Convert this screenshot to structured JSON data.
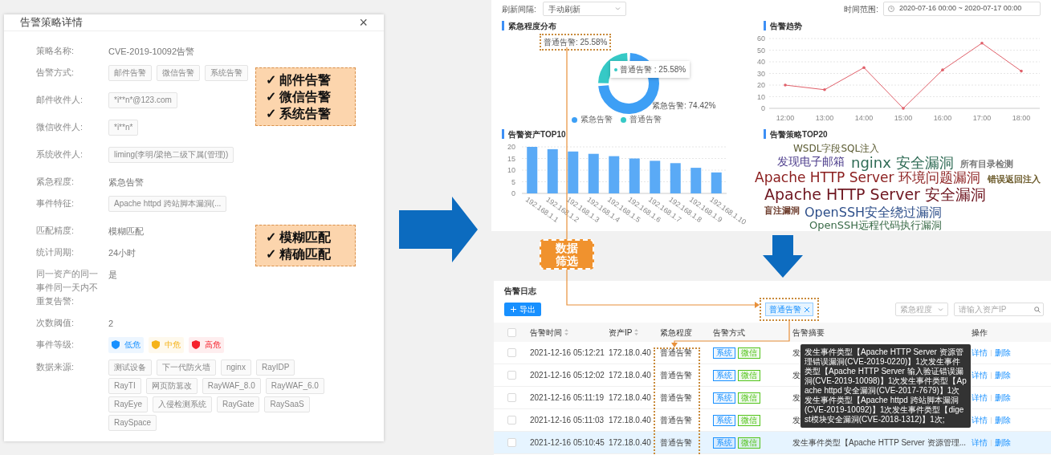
{
  "policy_dialog": {
    "title": "告警策略详情",
    "close": "×",
    "fields": [
      {
        "kind": "text",
        "label": "策略名称:",
        "value": "CVE-2019-10092告警"
      },
      {
        "kind": "tags",
        "label": "告警方式:",
        "tags": [
          "邮件告警",
          "微信告警",
          "系统告警"
        ]
      },
      {
        "kind": "tags",
        "label": "邮件收件人:",
        "tags": [
          "*i**n*@123.com"
        ]
      },
      {
        "kind": "tags",
        "label": "微信收件人:",
        "tags": [
          "*i**n*"
        ]
      },
      {
        "kind": "tags",
        "label": "系统收件人:",
        "tags": [
          "liming(李明/梁艳二级下属(管理))"
        ]
      },
      {
        "kind": "text",
        "label": "紧急程度:",
        "value": "紧急告警"
      },
      {
        "kind": "tags",
        "label": "事件特征:",
        "tags": [
          "Apache httpd 跨站脚本漏洞(..."
        ]
      },
      {
        "kind": "text",
        "label": "匹配精度:",
        "value": "模糊匹配"
      },
      {
        "kind": "text",
        "label": "统计周期:",
        "value": "24小时"
      },
      {
        "kind": "text",
        "label": "同一资产的同一事件同一天内不重复告警:",
        "value": "是"
      },
      {
        "kind": "text",
        "label": "次数阈值:",
        "value": "2"
      },
      {
        "kind": "levels",
        "label": "事件等级:",
        "levels": [
          {
            "label": "低危",
            "color": "#1890ff"
          },
          {
            "label": "中危",
            "color": "#f5b31a"
          },
          {
            "label": "高危",
            "color": "#f5222d"
          }
        ]
      },
      {
        "kind": "tags",
        "label": "数据来源:",
        "tags": [
          "测试设备",
          "下一代防火墙",
          "nginx",
          "RayIDP",
          "RayTI",
          "网页防篡改",
          "RayWAF_8.0",
          "RayWAF_6.0",
          "RayEye",
          "入侵检测系统",
          "RayGate",
          "RaySaaS",
          "RaySpace"
        ]
      }
    ]
  },
  "callouts": [
    {
      "items": [
        "✓ 邮件告警",
        "✓ 微信告警",
        "✓ 系统告警"
      ]
    },
    {
      "items": [
        "✓ 模糊匹配",
        "✓ 精确匹配"
      ]
    }
  ],
  "dashboard": {
    "refresh_label": "刷新间隔:",
    "refresh_value": "手动刷新",
    "time_label": "时间范围:",
    "time_value": "2020-07-16 00:00 ~ 2020-07-17 00:00",
    "panels": [
      {
        "title": "紧急程度分布",
        "tooltip": "普通告警 : 25.58%",
        "chart_data": {
          "type": "donut",
          "categories": [
            "紧急告警",
            "普通告警"
          ],
          "values": [
            74.42,
            25.58
          ],
          "value_labels": [
            "紧急告警: 74.42%",
            "普通告警: 25.58%"
          ],
          "legend": true
        }
      },
      {
        "title": "告警趋势",
        "chart_data": {
          "type": "line",
          "x": [
            "12:00",
            "13:00",
            "14:00",
            "15:00",
            "16:00",
            "17:00",
            "18:00"
          ],
          "series": [
            {
              "color": "#e0606a",
              "values": [
                20,
                16,
                35,
                0,
                33,
                56,
                32
              ]
            }
          ],
          "ylim": [
            0,
            60
          ],
          "yticks": [
            0,
            10,
            20,
            30,
            40,
            50,
            60
          ],
          "grid": true
        }
      },
      {
        "title": "告警资产TOP10",
        "chart_data": {
          "type": "bar",
          "categories": [
            "192.168.1.1",
            "192.168.1.2",
            "192.168.1.3",
            "192.168.1.4",
            "192.168.1.5",
            "192.168.1.6",
            "192.168.1.7",
            "192.168.1.8",
            "192.168.1.9",
            "192.168.1.10"
          ],
          "series": [
            {
              "color": "#5aaaf6",
              "values": [
                20,
                19,
                18,
                17,
                16,
                15,
                14,
                13,
                11,
                9
              ]
            }
          ],
          "ylim": [
            0,
            20
          ],
          "yticks": [
            0,
            5,
            10,
            15,
            20
          ],
          "grid": true
        }
      },
      {
        "kind": "cloud",
        "title": "告警策略TOP20",
        "words": [
          {
            "text": "WSDL字段SQL注入",
            "color": "#5b5b32"
          },
          {
            "text": "发现电子邮箱",
            "color": "#4a3a8a"
          },
          {
            "text": "nginx 安全漏洞",
            "color": "#2f6b55"
          },
          {
            "text": "所有目录检测",
            "color": "#777777"
          },
          {
            "text": "Apache HTTP Server 环境问题漏洞",
            "color": "#8a1c1c"
          },
          {
            "text": "错误返回注入",
            "color": "#6b5a2a"
          },
          {
            "text": "Apache HTTP Server 安全漏洞",
            "color": "#6e1620"
          },
          {
            "text": "盲注漏洞",
            "color": "#6b3a2a"
          },
          {
            "text": "OpenSSH安全绕过漏洞",
            "color": "#2e4f8a"
          },
          {
            "text": "OpenSSH远程代码执行漏洞",
            "color": "#3a6b48"
          }
        ]
      }
    ]
  },
  "filter_callout": "数据筛选",
  "alert_log": {
    "title": "告警日志",
    "export_label": "导出",
    "filter_chip": "普通告警",
    "level_select": "紧急程度",
    "search_placeholder": "请输入资产IP",
    "header_checked": false,
    "columns": [
      {
        "label": "告警时间",
        "sortable": true
      },
      {
        "label": "资产IP",
        "sortable": true
      },
      {
        "label": "紧急程度",
        "sortable": false
      },
      {
        "label": "告警方式",
        "sortable": false
      },
      {
        "label": "告警摘要",
        "sortable": false
      },
      {
        "label": "操作",
        "sortable": false
      }
    ],
    "rows": [
      {
        "time": "2021-12-16 05:12:21",
        "ip": "172.18.0.40",
        "level": "普通告警",
        "methods": [
          {
            "label": "系统",
            "color": "#1890ff"
          },
          {
            "label": "微信",
            "color": "#52c41a"
          }
        ],
        "summary": "发",
        "actions": [
          "详情",
          "删除"
        ],
        "checked": false,
        "selected": false
      },
      {
        "time": "2021-12-16 05:12:02",
        "ip": "172.18.0.40",
        "level": "普通告警",
        "methods": [
          {
            "label": "系统",
            "color": "#1890ff"
          },
          {
            "label": "微信",
            "color": "#52c41a"
          }
        ],
        "summary": "发",
        "actions": [
          "详情",
          "删除"
        ],
        "checked": false,
        "selected": false
      },
      {
        "time": "2021-12-16 05:11:19",
        "ip": "172.18.0.40",
        "level": "普通告警",
        "methods": [
          {
            "label": "系统",
            "color": "#1890ff"
          },
          {
            "label": "微信",
            "color": "#52c41a"
          }
        ],
        "summary": "发",
        "actions": [
          "详情",
          "删除"
        ],
        "checked": false,
        "selected": false
      },
      {
        "time": "2021-12-16 05:11:03",
        "ip": "172.18.0.40",
        "level": "普通告警",
        "methods": [
          {
            "label": "系统",
            "color": "#1890ff"
          },
          {
            "label": "微信",
            "color": "#52c41a"
          }
        ],
        "summary": "发",
        "actions": [
          "详情",
          "删除"
        ],
        "checked": false,
        "selected": false
      },
      {
        "time": "2021-12-16 05:10:45",
        "ip": "172.18.0.40",
        "level": "普通告警",
        "methods": [
          {
            "label": "系统",
            "color": "#1890ff"
          },
          {
            "label": "微信",
            "color": "#52c41a"
          }
        ],
        "summary": "发生事件类型【Apache HTTP Server 资源管理...",
        "actions": [
          "详情",
          "删除"
        ],
        "checked": false,
        "selected": true
      }
    ],
    "tooltip": "发生事件类型【Apache HTTP Server 资源管理错误漏洞(CVE-2019-0220)】1次发生事件类型【Apache HTTP Server 输入验证错误漏洞(CVE-2019-10098)】1次发生事件类型【Apache httpd 安全漏洞(CVE-2017-7679)】1次发生事件类型【Apache httpd 跨站脚本漏洞(CVE-2019-10092)】1次发生事件类型【digest模块安全漏洞(CVE-2018-1312)】1次;"
  }
}
